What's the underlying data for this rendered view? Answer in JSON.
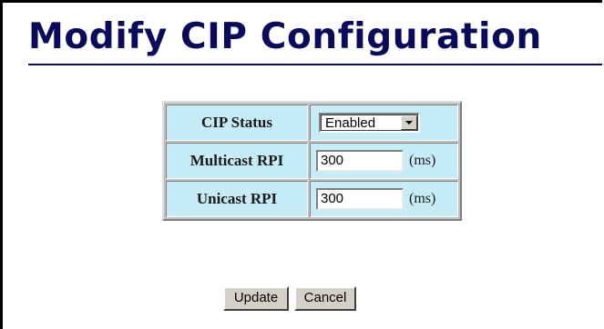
{
  "page": {
    "title": "Modify CIP Configuration"
  },
  "config": {
    "cip_status": {
      "label": "CIP Status",
      "value": "Enabled"
    },
    "multicast_rpi": {
      "label": "Multicast RPI",
      "value": "300",
      "unit": "(ms)"
    },
    "unicast_rpi": {
      "label": "Unicast RPI",
      "value": "300",
      "unit": "(ms)"
    }
  },
  "buttons": {
    "update": "Update",
    "cancel": "Cancel"
  },
  "colors": {
    "title": "#0a0a5c",
    "cell_bg": "#c5ecf7",
    "button_bg": "#d4d0c8"
  }
}
